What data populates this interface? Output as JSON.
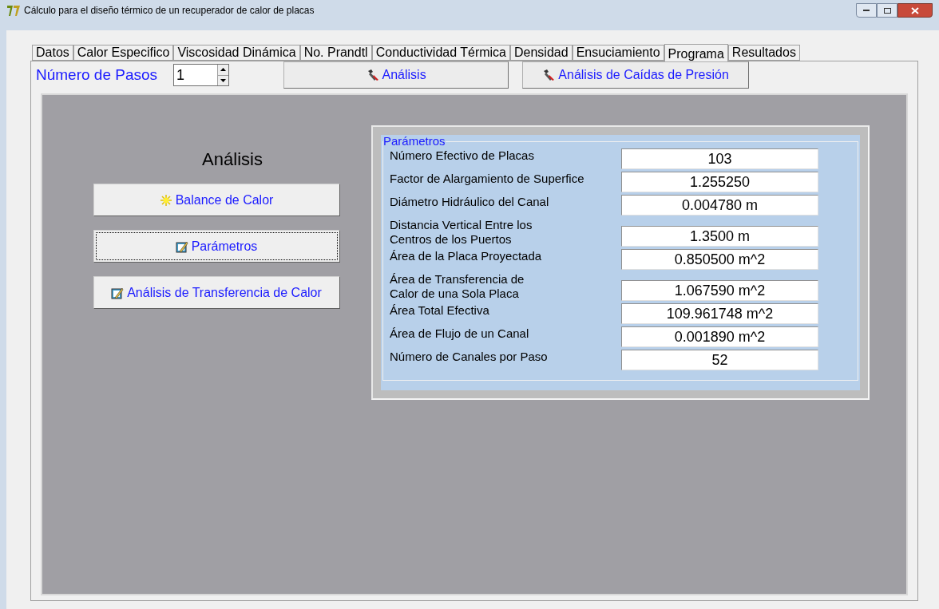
{
  "window": {
    "title": "Cálculo para el diseño térmico de un recuperador de calor de placas"
  },
  "tabs": [
    {
      "label": "Datos",
      "selected": false
    },
    {
      "label": "Calor Especifico",
      "selected": false
    },
    {
      "label": "Viscosidad Dinámica",
      "selected": false
    },
    {
      "label": "No. Prandtl",
      "selected": false
    },
    {
      "label": "Conductividad Térmica",
      "selected": false
    },
    {
      "label": "Densidad",
      "selected": false
    },
    {
      "label": "Ensuciamiento",
      "selected": false
    },
    {
      "label": "Programa",
      "selected": true
    },
    {
      "label": "Resultados",
      "selected": false
    }
  ],
  "toolbar": {
    "steps_label": "Número de Pasos",
    "steps_value": "1",
    "buttons": [
      "Análisis",
      "Análisis de Caídas de Presión"
    ]
  },
  "analysis": {
    "heading": "Análisis",
    "buttons": [
      {
        "label": "Balance de Calor",
        "kind": "sun",
        "focused": false
      },
      {
        "label": "Parámetros",
        "kind": "notepad",
        "focused": true
      },
      {
        "label": "Análisis de Transferencia de Calor",
        "kind": "notepad",
        "focused": false
      }
    ]
  },
  "parameters": {
    "title": "Parámetros",
    "rows": [
      {
        "label": "Número Efectivo de Placas",
        "value": "103"
      },
      {
        "label": "Factor de Alargamiento de Superfice",
        "value": "1.255250"
      },
      {
        "label": "Diámetro Hidráulico del Canal",
        "value": "0.004780 m"
      },
      {
        "label": "Distancia Vertical Entre los\nCentros de los Puertos",
        "value": "1.3500 m"
      },
      {
        "label": "Área de la Placa Proyectada",
        "value": "0.850500 m^2"
      },
      {
        "label": "Área de Transferencia de\nCalor de una Sola Placa",
        "value": "1.067590 m^2"
      },
      {
        "label": "Área Total Efectiva",
        "value": "109.961748 m^2"
      },
      {
        "label": "Área de Flujo de un Canal",
        "value": "0.001890 m^2"
      },
      {
        "label": "Número de Canales por Paso",
        "value": "52"
      }
    ]
  }
}
